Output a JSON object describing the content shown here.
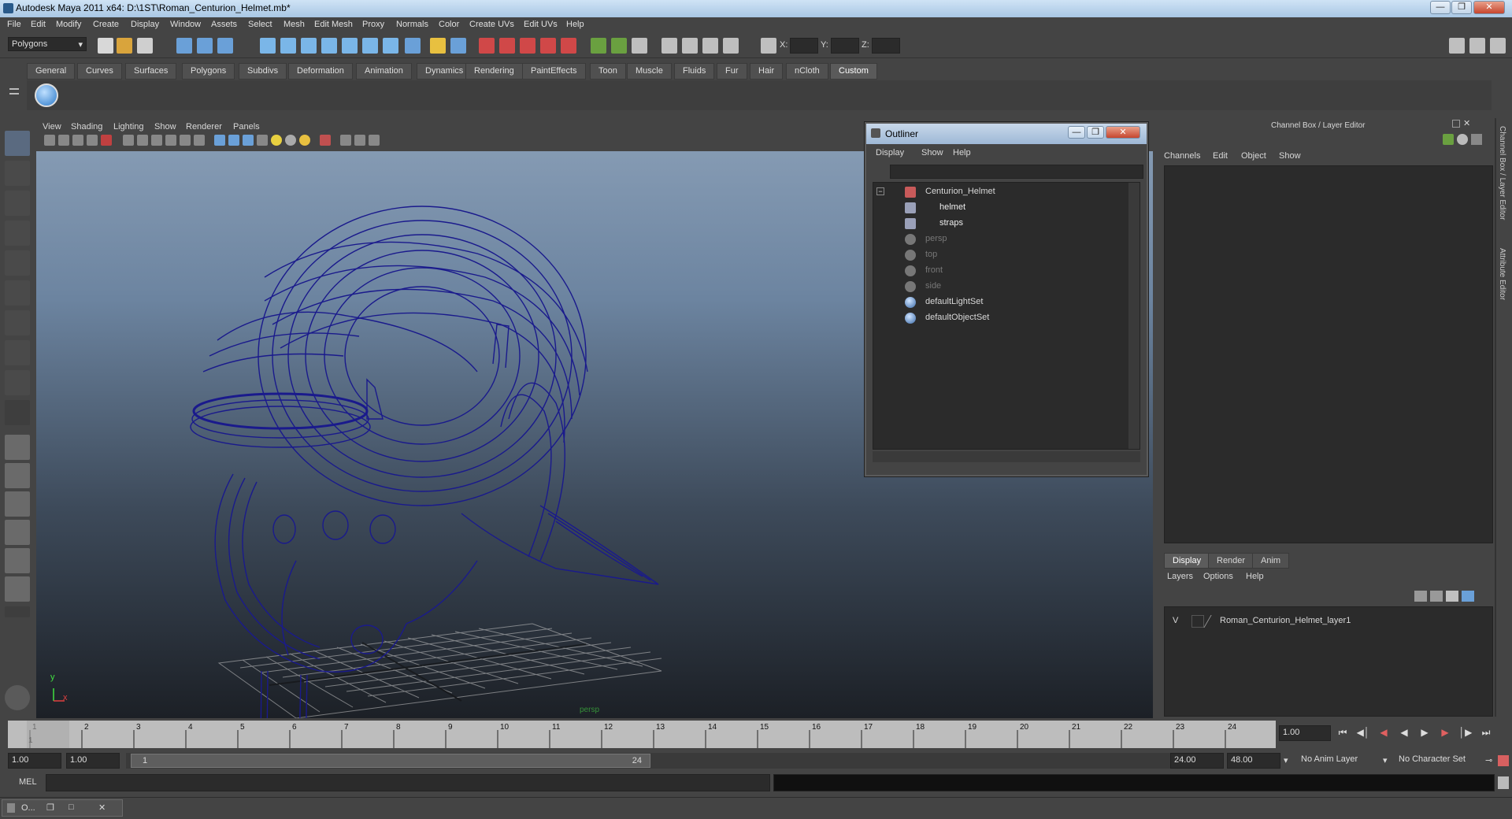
{
  "window": {
    "title": "Autodesk Maya 2011 x64: D:\\1ST\\Roman_Centurion_Helmet.mb*"
  },
  "menubar": [
    "File",
    "Edit",
    "Modify",
    "Create",
    "Display",
    "Window",
    "Assets",
    "Select",
    "Mesh",
    "Edit Mesh",
    "Proxy",
    "Normals",
    "Color",
    "Create UVs",
    "Edit UVs",
    "Help"
  ],
  "statusline": {
    "mode": "Polygons",
    "x_label": "X:",
    "y_label": "Y:",
    "z_label": "Z:"
  },
  "shelf_tabs": [
    "General",
    "Curves",
    "Surfaces",
    "Polygons",
    "Subdivs",
    "Deformation",
    "Animation",
    "Dynamics",
    "Rendering",
    "PaintEffects",
    "Toon",
    "Muscle",
    "Fluids",
    "Fur",
    "Hair",
    "nCloth",
    "Custom"
  ],
  "shelf_active": "Custom",
  "viewport": {
    "menu": [
      "View",
      "Shading",
      "Lighting",
      "Show",
      "Renderer",
      "Panels"
    ],
    "camera_label": "persp",
    "axis_y": "y",
    "axis_x": "x",
    "wire_color": "#1a1a8c"
  },
  "outliner": {
    "title": "Outliner",
    "menu": [
      "Display",
      "Show",
      "Help"
    ],
    "items": [
      {
        "label": "Centurion_Helmet",
        "type": "transform",
        "dim": false
      },
      {
        "label": "helmet",
        "type": "mesh",
        "dim": false
      },
      {
        "label": "straps",
        "type": "mesh",
        "dim": false
      },
      {
        "label": "persp",
        "type": "camera",
        "dim": true
      },
      {
        "label": "top",
        "type": "camera",
        "dim": true
      },
      {
        "label": "front",
        "type": "camera",
        "dim": true
      },
      {
        "label": "side",
        "type": "camera",
        "dim": true
      },
      {
        "label": "defaultLightSet",
        "type": "set",
        "dim": false
      },
      {
        "label": "defaultObjectSet",
        "type": "set",
        "dim": false
      }
    ]
  },
  "channelbox": {
    "header": "Channel Box / Layer Editor",
    "menu": [
      "Channels",
      "Edit",
      "Object",
      "Show"
    ],
    "side_tab_1": "Channel Box / Layer Editor",
    "side_tab_2": "Attribute Editor",
    "layer_tabs": [
      "Display",
      "Render",
      "Anim"
    ],
    "layer_menu": [
      "Layers",
      "Options",
      "Help"
    ],
    "layer": {
      "visible": "V",
      "name": "Roman_Centurion_Helmet_layer1"
    }
  },
  "timeline": {
    "ticks": [
      "1",
      "2",
      "3",
      "4",
      "5",
      "6",
      "7",
      "8",
      "9",
      "10",
      "11",
      "12",
      "13",
      "14",
      "15",
      "16",
      "17",
      "18",
      "19",
      "20",
      "21",
      "22",
      "23",
      "24"
    ],
    "current_frame": "1",
    "current_time": "1.00"
  },
  "range": {
    "start_time": "1.00",
    "playback_start": "1.00",
    "range_start": "1",
    "range_end": "24",
    "playback_end": "24.00",
    "end_time": "48.00",
    "anim_layer": "No Anim Layer",
    "char_set": "No Character Set"
  },
  "cmdline": {
    "label": "MEL"
  },
  "taskbar": {
    "label": "O..."
  }
}
